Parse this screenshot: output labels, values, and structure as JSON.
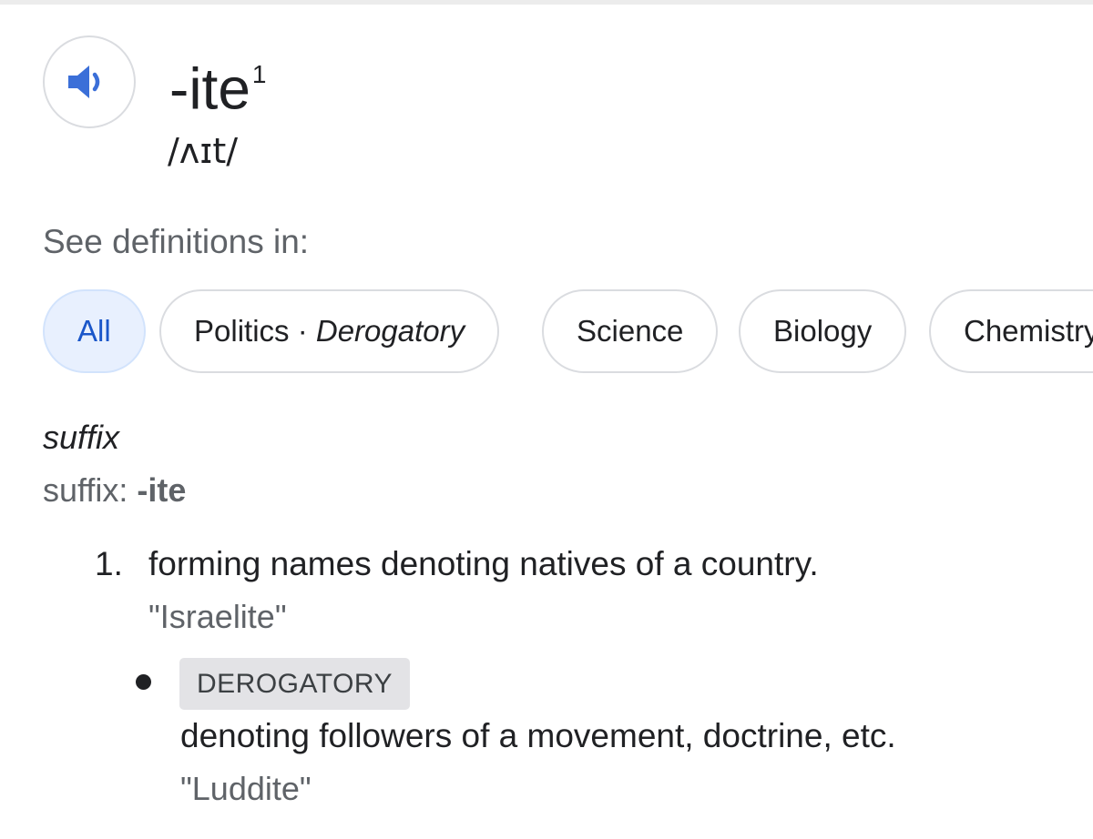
{
  "entry": {
    "headword": "-ite",
    "homograph_number": "1",
    "phonetic": "/ʌɪt/",
    "audio_icon": "speaker-icon"
  },
  "see_definitions": {
    "label": "See definitions in:",
    "chips": [
      {
        "label": "All",
        "sub": "",
        "active": true
      },
      {
        "label": "Politics · ",
        "sub": "Derogatory",
        "active": false
      },
      {
        "label": "Science",
        "sub": "",
        "active": false
      },
      {
        "label": "Biology",
        "sub": "",
        "active": false
      },
      {
        "label": "Chemistry",
        "sub": "",
        "active": false
      }
    ]
  },
  "sense": {
    "part_of_speech": "suffix",
    "form_label": "suffix: ",
    "form": "-ite",
    "definitions": [
      {
        "number": "1.",
        "text": "forming names denoting natives of a country.",
        "example": "\"Israelite\""
      }
    ],
    "sub_definitions": [
      {
        "badge": "DEROGATORY",
        "text": "denoting followers of a movement, doctrine, etc.",
        "example": "\"Luddite\""
      }
    ]
  },
  "colors": {
    "accent_blue": "#3b6fd8",
    "chip_active_bg": "#e8f0fe",
    "muted_text": "#5f6368",
    "badge_bg": "#e3e3e6"
  }
}
